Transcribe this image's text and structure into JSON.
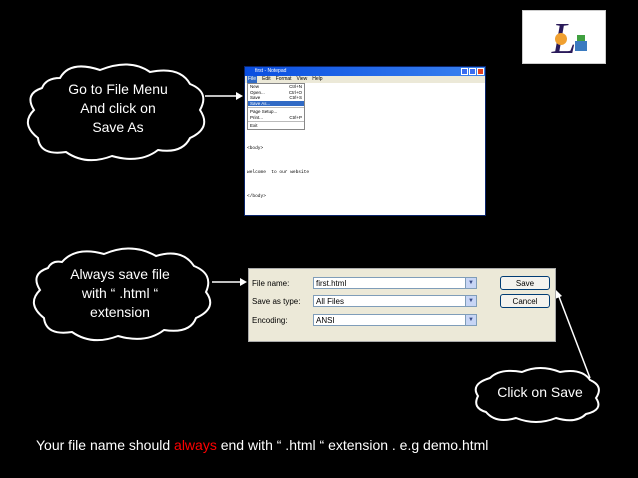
{
  "callouts": {
    "file_menu": [
      "Go to File Menu",
      "And click on",
      "Save As"
    ],
    "extension": [
      "Always save file",
      "with “ .html “",
      "extension"
    ],
    "click_save": [
      "Click on Save"
    ]
  },
  "notepad": {
    "title": "first - Notepad",
    "menu": [
      "File",
      "Edit",
      "Format",
      "View",
      "Help"
    ],
    "file_menu_items": [
      {
        "label": "New",
        "shortcut": "Ctrl+N"
      },
      {
        "label": "Open...",
        "shortcut": "Ctrl+O"
      },
      {
        "label": "Save",
        "shortcut": "Ctrl+S"
      },
      {
        "label": "Save As...",
        "shortcut": ""
      },
      {
        "label": "Page Setup...",
        "shortcut": ""
      },
      {
        "label": "Print...",
        "shortcut": "Ctrl+P"
      },
      {
        "label": "Exit",
        "shortcut": ""
      }
    ],
    "body_lines": [
      "<body>",
      "welcome  to our website",
      "</body>",
      "</html>"
    ]
  },
  "save_dialog": {
    "file_name_label": "File name:",
    "file_name_value": "first.html",
    "save_as_type_label": "Save as type:",
    "save_as_type_value": "All Files",
    "encoding_label": "Encoding:",
    "encoding_value": "ANSI",
    "save_button": "Save",
    "cancel_button": "Cancel"
  },
  "footer": {
    "before": "Your file name should ",
    "highlight": "always",
    "after": " end with “ .html “ extension .  e.g demo.html"
  },
  "colors": {
    "highlight": "#ff0000",
    "background": "#000000",
    "text": "#ffffff"
  },
  "logo": {
    "letter": "L"
  }
}
